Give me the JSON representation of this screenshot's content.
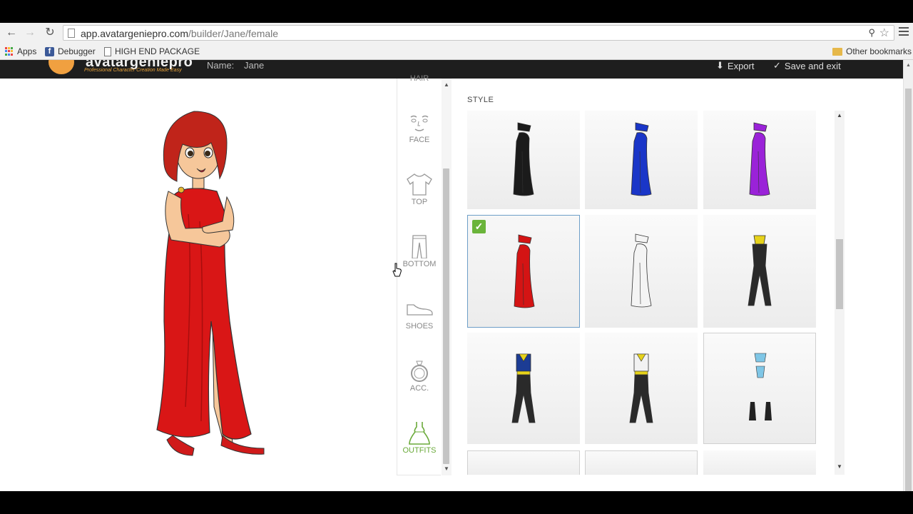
{
  "browser": {
    "url_host": "app.avatargeniepro.com",
    "url_path": "/builder/Jane/female",
    "bookmarks": [
      {
        "label": "Apps",
        "icon": "apps-grid-icon"
      },
      {
        "label": "Debugger",
        "icon": "facebook-icon"
      },
      {
        "label": "HIGH END PACKAGE",
        "icon": "page-icon"
      }
    ],
    "other_bookmarks": "Other bookmarks"
  },
  "header": {
    "logo_text": "avatargeniepro",
    "tagline": "Professional Character Creation Made Easy",
    "name_label": "Name:",
    "name_value": "Jane",
    "export_label": "Export",
    "save_label": "Save and exit"
  },
  "categories": [
    {
      "id": "hair",
      "label": "HAIR",
      "icon": "hair-icon",
      "active": false
    },
    {
      "id": "face",
      "label": "FACE",
      "icon": "face-icon",
      "active": false
    },
    {
      "id": "top",
      "label": "TOP",
      "icon": "shirt-icon",
      "active": false
    },
    {
      "id": "bottom",
      "label": "BOTTOM",
      "icon": "pants-icon",
      "active": false
    },
    {
      "id": "shoes",
      "label": "SHOES",
      "icon": "shoe-icon",
      "active": false
    },
    {
      "id": "acc",
      "label": "ACC.",
      "icon": "ring-icon",
      "active": false
    },
    {
      "id": "outfits",
      "label": "OUTFITS",
      "icon": "dress-icon",
      "active": true
    }
  ],
  "style_panel": {
    "title": "STYLE",
    "items": [
      {
        "name": "black-gown-outfit",
        "color": "#1b1b1b",
        "kind": "gown",
        "selected": false
      },
      {
        "name": "blue-gown-outfit",
        "color": "#1a36c8",
        "kind": "gown",
        "selected": false
      },
      {
        "name": "purple-gown-outfit",
        "color": "#9a22d8",
        "kind": "gown",
        "selected": false
      },
      {
        "name": "red-gown-outfit",
        "color": "#d41414",
        "kind": "gown",
        "selected": true
      },
      {
        "name": "white-gown-outfit",
        "color": "#f4f4f4",
        "kind": "gown",
        "selected": false
      },
      {
        "name": "black-catsuit-outfit",
        "color": "#2a2a2a",
        "kind": "suit",
        "accent": "#e6d21a",
        "selected": false
      },
      {
        "name": "blue-hero-outfit",
        "color": "#1c3c94",
        "kind": "hero",
        "accent": "#e6d21a",
        "selected": false
      },
      {
        "name": "white-hero-outfit",
        "color": "#f2f2f2",
        "kind": "hero",
        "accent": "#e6d21a",
        "selected": false
      },
      {
        "name": "light-blue-top-outfit",
        "color": "#7fc6e6",
        "kind": "split",
        "selected": false
      }
    ]
  },
  "colors": {
    "accent_green": "#6ab43a",
    "selected_border": "#6d9ec8",
    "header_bg": "#1e1e1e"
  }
}
